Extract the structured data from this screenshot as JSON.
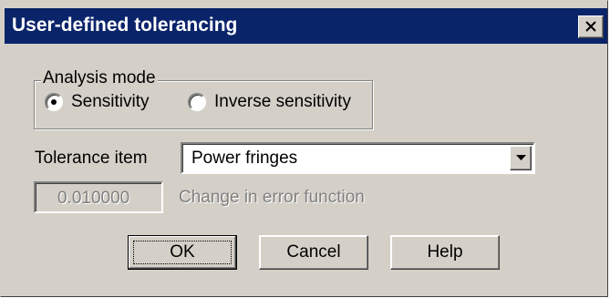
{
  "window": {
    "title": "User-defined tolerancing"
  },
  "analysis_mode": {
    "group_label": "Analysis mode",
    "options": [
      {
        "label": "Sensitivity",
        "selected": true
      },
      {
        "label": "Inverse sensitivity",
        "selected": false
      }
    ]
  },
  "tolerance_item": {
    "label": "Tolerance item",
    "value": "Power fringes"
  },
  "error_function": {
    "value": "0.010000",
    "label": "Change in error function"
  },
  "buttons": {
    "ok": "OK",
    "cancel": "Cancel",
    "help": "Help"
  },
  "colors": {
    "titlebar": "#0a246a",
    "face": "#d4d0c8",
    "disabled_text": "#808080"
  },
  "icons": {
    "close": "close-icon",
    "dropdown": "chevron-down-icon"
  }
}
